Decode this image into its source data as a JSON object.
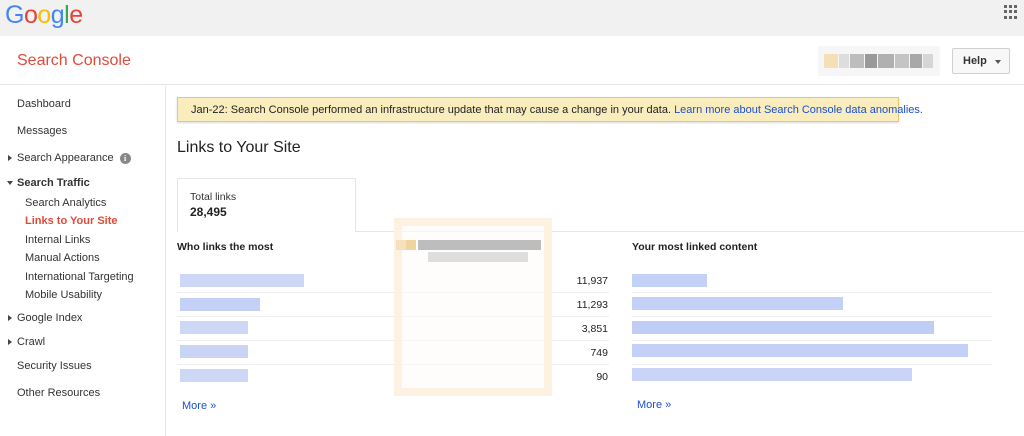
{
  "topbar": {
    "logo": [
      {
        "ch": "G",
        "color": "#4285f4"
      },
      {
        "ch": "o",
        "color": "#ea4335"
      },
      {
        "ch": "o",
        "color": "#fbbc05"
      },
      {
        "ch": "g",
        "color": "#4285f4"
      },
      {
        "ch": "l",
        "color": "#34a853"
      },
      {
        "ch": "e",
        "color": "#ea4335"
      }
    ],
    "apps_icon": "apps-grid-icon"
  },
  "header": {
    "product_name": "Search Console",
    "help_label": "Help"
  },
  "sidebar": {
    "dashboard": "Dashboard",
    "messages": "Messages",
    "search_appearance": "Search Appearance",
    "info_glyph": "i",
    "search_traffic": "Search Traffic",
    "search_traffic_items": [
      "Search Analytics",
      "Links to Your Site",
      "Internal Links",
      "Manual Actions",
      "International Targeting",
      "Mobile Usability"
    ],
    "google_index": "Google Index",
    "crawl": "Crawl",
    "security_issues": "Security Issues",
    "other_resources": "Other Resources"
  },
  "banner": {
    "text": "Jan-22: Search Console performed an infrastructure update that may cause a change in your data. ",
    "link": "Learn more about Search Console data anomalies."
  },
  "main": {
    "title": "Links to Your Site",
    "total_links_label": "Total links",
    "total_links_value": "28,495",
    "who_links_heading": "Who links the most",
    "who_links_counts": [
      "11,937",
      "11,293",
      "3,851",
      "749",
      "90"
    ],
    "who_links_more": "More »",
    "most_linked_heading": "Your most linked content",
    "most_linked_more": "More »"
  },
  "colors": {
    "brand_red": "#dd4b39",
    "link_blue": "#1a4fd0",
    "banner_bg": "#f9edbe",
    "redacted_blue": "#c9d5f7"
  }
}
